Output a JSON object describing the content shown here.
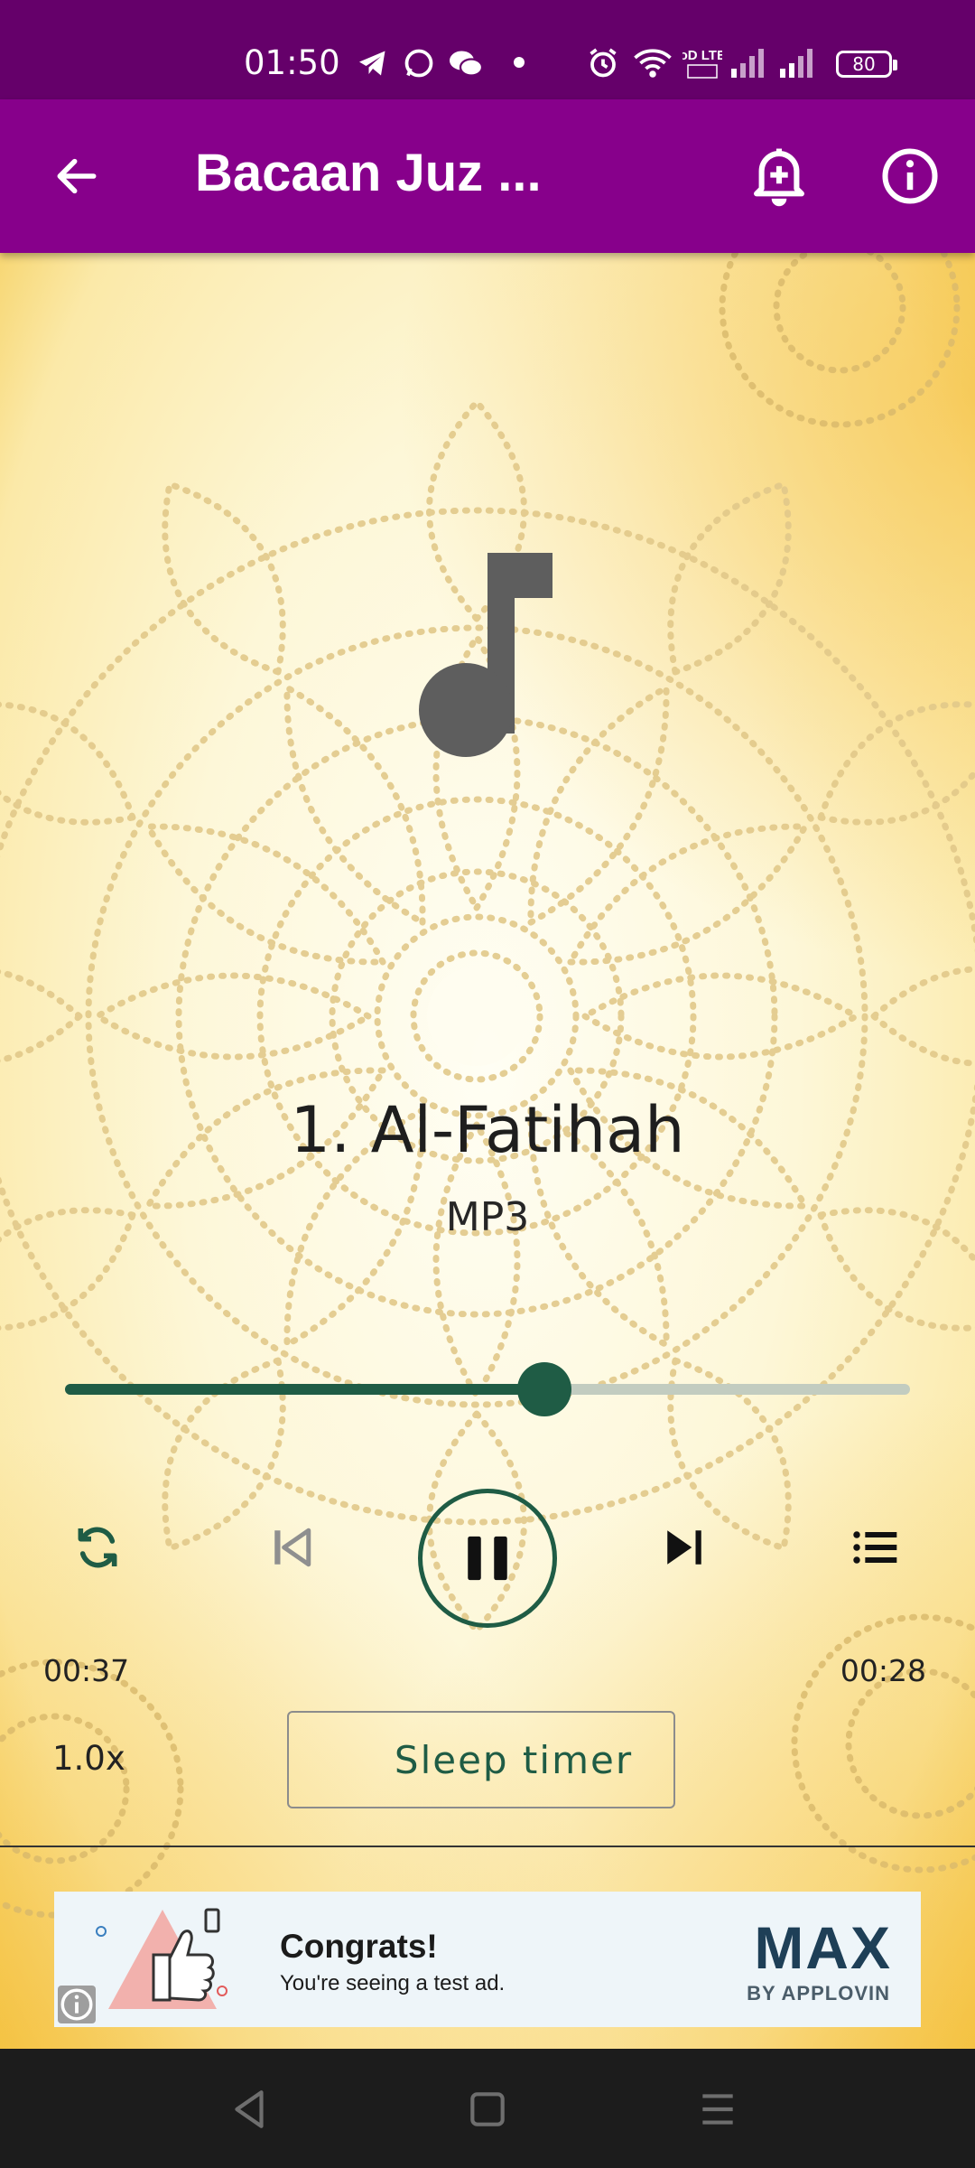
{
  "status_bar": {
    "time": "01:50",
    "battery": "80",
    "network_label": "VoD LTE2",
    "icons": [
      "telegram-icon",
      "whatsapp-icon",
      "wechat-icon",
      "dot-icon",
      "alarm-icon",
      "wifi-icon",
      "network-type-icon",
      "signal-icon",
      "battery-icon"
    ]
  },
  "app_bar": {
    "title": "Bacaan Juz ...",
    "icons": [
      "back-arrow-icon",
      "add-alarm-icon",
      "info-icon"
    ],
    "color": "#87008b"
  },
  "player": {
    "track_title": "1. Al-Fatihah",
    "track_subtitle": "MP3",
    "elapsed": "00:37",
    "remaining": "00:28",
    "progress": 0.567,
    "accent_color": "#1f5c45",
    "controls": [
      "repeat-icon",
      "previous-icon",
      "pause-icon",
      "next-icon",
      "playlist-icon"
    ],
    "speed": "1.0x",
    "sleep_timer_label": "Sleep timer"
  },
  "ad": {
    "headline": "Congrats!",
    "body": "You're seeing a test ad.",
    "brand": "MAX",
    "brand_sub": "BY APPLOVIN"
  },
  "nav_bar": {
    "icons": [
      "back-triangle-icon",
      "home-square-icon",
      "menu-lines-icon"
    ]
  }
}
